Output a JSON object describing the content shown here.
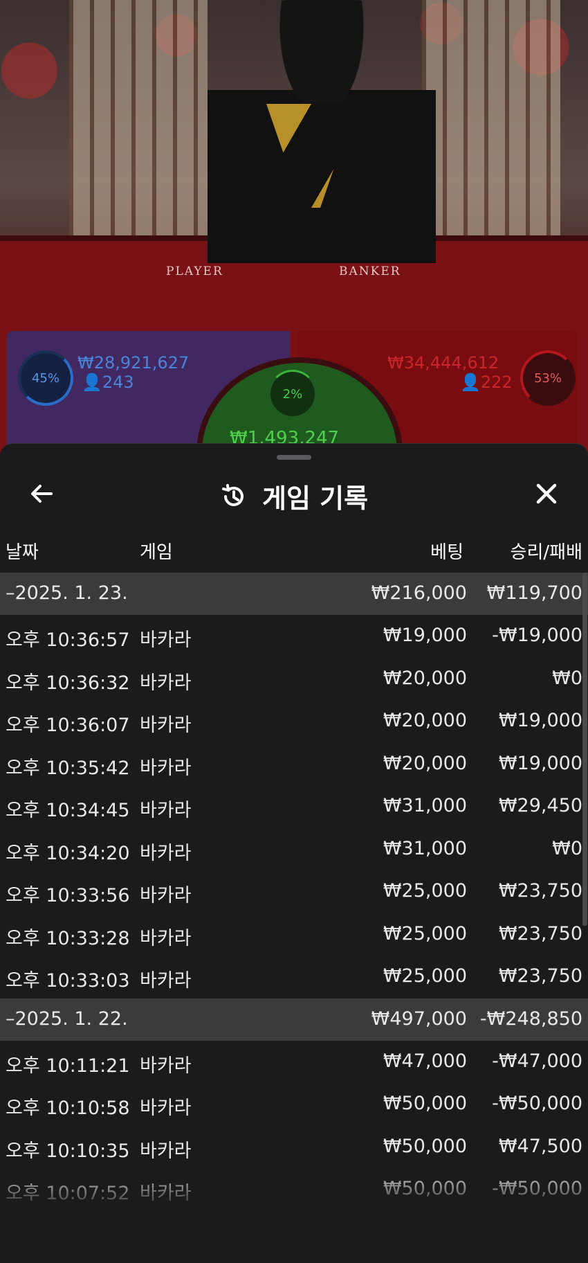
{
  "video": {
    "table_labels": [
      "PLAYER",
      "BANKER"
    ]
  },
  "stats": {
    "player": {
      "percent": "45%",
      "amount": "₩28,921,627",
      "count": "243"
    },
    "banker": {
      "percent": "53%",
      "amount": "₩34,444,612",
      "count": "222"
    },
    "tie": {
      "percent": "2%",
      "amount": "₩1,493,247"
    }
  },
  "header": {
    "title": "게임 기록",
    "back_icon": "arrow-left-icon",
    "close_icon": "close-icon",
    "history_icon": "history-icon"
  },
  "columns": {
    "date": "날짜",
    "game": "게임",
    "bet": "베팅",
    "result": "승리/패배"
  },
  "groups": [
    {
      "date": "–2025. 1. 23.",
      "bet_total": "₩216,000",
      "result_total": "₩119,700",
      "rows": [
        {
          "time": "오후 10:36:57",
          "game": "바카라",
          "bet": "₩19,000",
          "result": "-₩19,000"
        },
        {
          "time": "오후 10:36:32",
          "game": "바카라",
          "bet": "₩20,000",
          "result": "₩0"
        },
        {
          "time": "오후 10:36:07",
          "game": "바카라",
          "bet": "₩20,000",
          "result": "₩19,000"
        },
        {
          "time": "오후 10:35:42",
          "game": "바카라",
          "bet": "₩20,000",
          "result": "₩19,000"
        },
        {
          "time": "오후 10:34:45",
          "game": "바카라",
          "bet": "₩31,000",
          "result": "₩29,450"
        },
        {
          "time": "오후 10:34:20",
          "game": "바카라",
          "bet": "₩31,000",
          "result": "₩0"
        },
        {
          "time": "오후 10:33:56",
          "game": "바카라",
          "bet": "₩25,000",
          "result": "₩23,750"
        },
        {
          "time": "오후 10:33:28",
          "game": "바카라",
          "bet": "₩25,000",
          "result": "₩23,750"
        },
        {
          "time": "오후 10:33:03",
          "game": "바카라",
          "bet": "₩25,000",
          "result": "₩23,750"
        }
      ]
    },
    {
      "date": "–2025. 1. 22.",
      "bet_total": "₩497,000",
      "result_total": "-₩248,850",
      "rows": [
        {
          "time": "오후 10:11:21",
          "game": "바카라",
          "bet": "₩47,000",
          "result": "-₩47,000"
        },
        {
          "time": "오후 10:10:58",
          "game": "바카라",
          "bet": "₩50,000",
          "result": "-₩50,000"
        },
        {
          "time": "오후 10:10:35",
          "game": "바카라",
          "bet": "₩50,000",
          "result": "₩47,500"
        },
        {
          "time": "오후 10:07:52",
          "game": "바카라",
          "bet": "₩50,000",
          "result": "-₩50,000"
        }
      ]
    }
  ]
}
